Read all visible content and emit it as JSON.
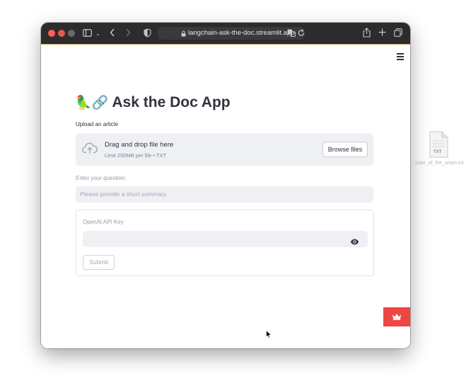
{
  "browser": {
    "url": "langchain-ask-the-doc.streamlit.app"
  },
  "app": {
    "title": "Ask the Doc App",
    "title_emoji": "🦜🔗",
    "upload": {
      "label": "Upload an article",
      "drop_text": "Drag and drop file here",
      "limit_text": "Limit 200MB per file • TXT",
      "browse_label": "Browse files"
    },
    "question": {
      "label": "Enter your question:",
      "placeholder": "Please provide a short summary."
    },
    "form": {
      "api_key_label": "OpenAI API Key",
      "api_key_value": "",
      "submit_label": "Submit"
    }
  },
  "desktop": {
    "file_label": "state_of_the_union.txt",
    "file_icon_text": "TXT"
  },
  "colors": {
    "accent": "#ee4545",
    "input_bg": "#eef0f4",
    "text": "#31333f",
    "titlebar": "#2c2c2e"
  }
}
